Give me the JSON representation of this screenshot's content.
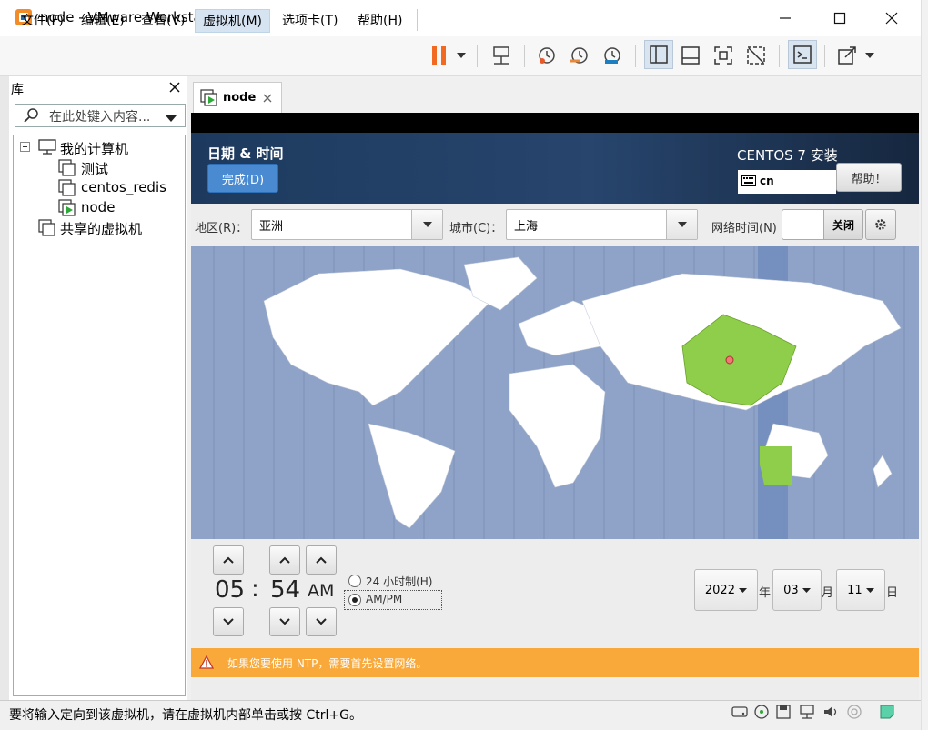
{
  "window": {
    "title": "node - VMware Workstation"
  },
  "menu": [
    "文件(F)",
    "编辑(E)",
    "查看(V)",
    "虚拟机(M)",
    "选项卡(T)",
    "帮助(H)"
  ],
  "library": {
    "title": "库",
    "search_placeholder": "在此处键入内容...",
    "tree": {
      "my_computer": "我的计算机",
      "vms": [
        "测试",
        "centos_redis",
        "node"
      ],
      "shared": "共享的虚拟机"
    }
  },
  "tab": {
    "label": "node"
  },
  "installer": {
    "title": "日期 & 时间",
    "done_label": "完成(D)",
    "product": "CENTOS 7 安装",
    "keyboard": "cn",
    "help_label": "帮助！",
    "region_label": "地区(R)：",
    "region_value": "亚洲",
    "city_label": "城市(C)：",
    "city_value": "上海",
    "ntp_label": "网络时间(N)",
    "ntp_state": "关闭",
    "time": {
      "hour": "05",
      "sep": ":",
      "minute": "54",
      "ampm": "AM"
    },
    "format_24": "24 小时制(H)",
    "format_ampm": "AM/PM",
    "selected_format": "AM/PM",
    "date": {
      "year": "2022",
      "year_unit": "年",
      "month": "03",
      "month_unit": "月",
      "day": "11",
      "day_unit": "日"
    },
    "warning": "如果您要使用 NTP，需要首先设置网络。"
  },
  "statusbar": {
    "text": "要将输入定向到该虚拟机，请在虚拟机内部单击或按 Ctrl+G。"
  },
  "colors": {
    "header_bg": "#1d3a5e",
    "accent_blue": "#4a8ad0",
    "map_ocean": "#8ea3c7",
    "map_selected": "#8fce4a",
    "warning_bar": "#f9a83a",
    "pause_icon": "#f26a21"
  }
}
